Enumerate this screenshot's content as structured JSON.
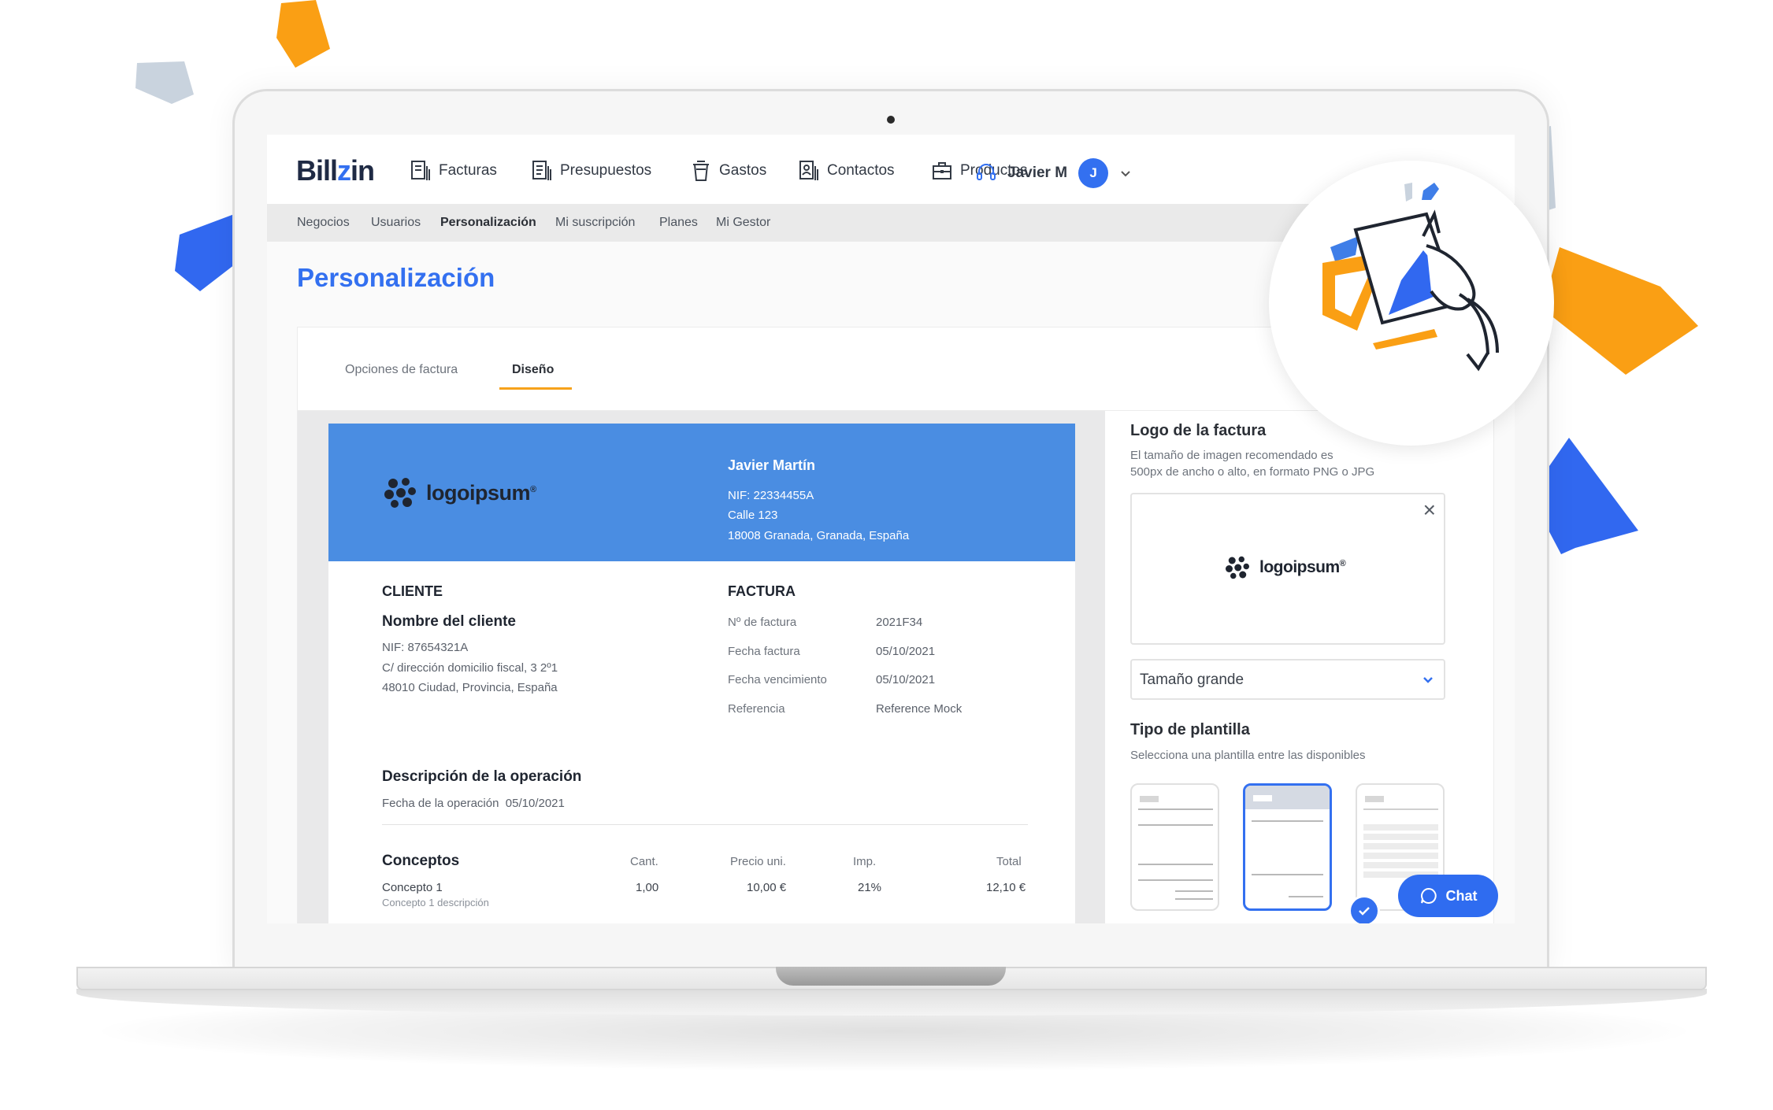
{
  "app": {
    "brand_prefix": "Bill",
    "brand_suffix": "in"
  },
  "nav": {
    "items": [
      {
        "label": "Facturas",
        "icon": "invoice-icon"
      },
      {
        "label": "Presupuestos",
        "icon": "budget-icon"
      },
      {
        "label": "Gastos",
        "icon": "cup-icon"
      },
      {
        "label": "Contactos",
        "icon": "contacts-icon"
      },
      {
        "label": "Productos",
        "icon": "briefcase-icon"
      }
    ],
    "user_name": "Javier M",
    "avatar_initial": "J"
  },
  "subnav": {
    "items": [
      "Negocios",
      "Usuarios",
      "Personalización",
      "Mi suscripción",
      "Planes",
      "Mi Gestor"
    ],
    "active": "Personalización"
  },
  "page": {
    "title": "Personalización"
  },
  "tabs": {
    "items": [
      "Opciones de factura",
      "Diseño"
    ],
    "active": "Diseño"
  },
  "invoice": {
    "logo_text": "logoipsum",
    "issuer": {
      "name": "Javier Martín",
      "nif": "NIF: 22334455A",
      "street": "Calle 123",
      "city": "18008 Granada, Granada, España"
    },
    "client": {
      "section_title": "CLIENTE",
      "name": "Nombre del cliente",
      "nif": "NIF: 87654321A",
      "address": "C/ dirección domicilio fiscal, 3 2º1",
      "city": "48010 Ciudad, Provincia, España"
    },
    "details": {
      "section_title": "FACTURA",
      "rows": [
        {
          "label": "Nº de factura",
          "value": "2021F34"
        },
        {
          "label": "Fecha factura",
          "value": "05/10/2021"
        },
        {
          "label": "Fecha vencimiento",
          "value": "05/10/2021"
        },
        {
          "label": "Referencia",
          "value": "Reference Mock"
        }
      ]
    },
    "operation": {
      "title": "Descripción de la operación",
      "date_label": "Fecha de la operación",
      "date_value": "05/10/2021"
    },
    "concepts": {
      "title": "Conceptos",
      "headers": {
        "qty": "Cant.",
        "price": "Precio uni.",
        "tax": "Imp.",
        "total": "Total"
      },
      "rows": [
        {
          "name": "Concepto 1",
          "description": "Concepto 1 descripción",
          "qty": "1,00",
          "price": "10,00 €",
          "tax": "21%",
          "total": "12,10 €"
        }
      ]
    }
  },
  "panel": {
    "logo_title": "Logo de la factura",
    "logo_help_1": "El tamaño de imagen recomendado es",
    "logo_help_2": "500px de ancho o alto, en formato PNG o JPG",
    "logo_preview_text": "logoipsum",
    "size_select_value": "Tamaño grande",
    "template_title": "Tipo de plantilla",
    "template_help": "Selecciona una plantilla entre las disponibles",
    "selected_template": 2
  },
  "chat": {
    "label": "Chat"
  },
  "colors": {
    "accent": "#3370f0",
    "invoice_header": "#4a8de2",
    "tab_underline": "#f7a21b",
    "confetti_orange": "#fa9f14",
    "confetti_blue": "#3168f0",
    "confetti_grey": "#c9d3de"
  }
}
